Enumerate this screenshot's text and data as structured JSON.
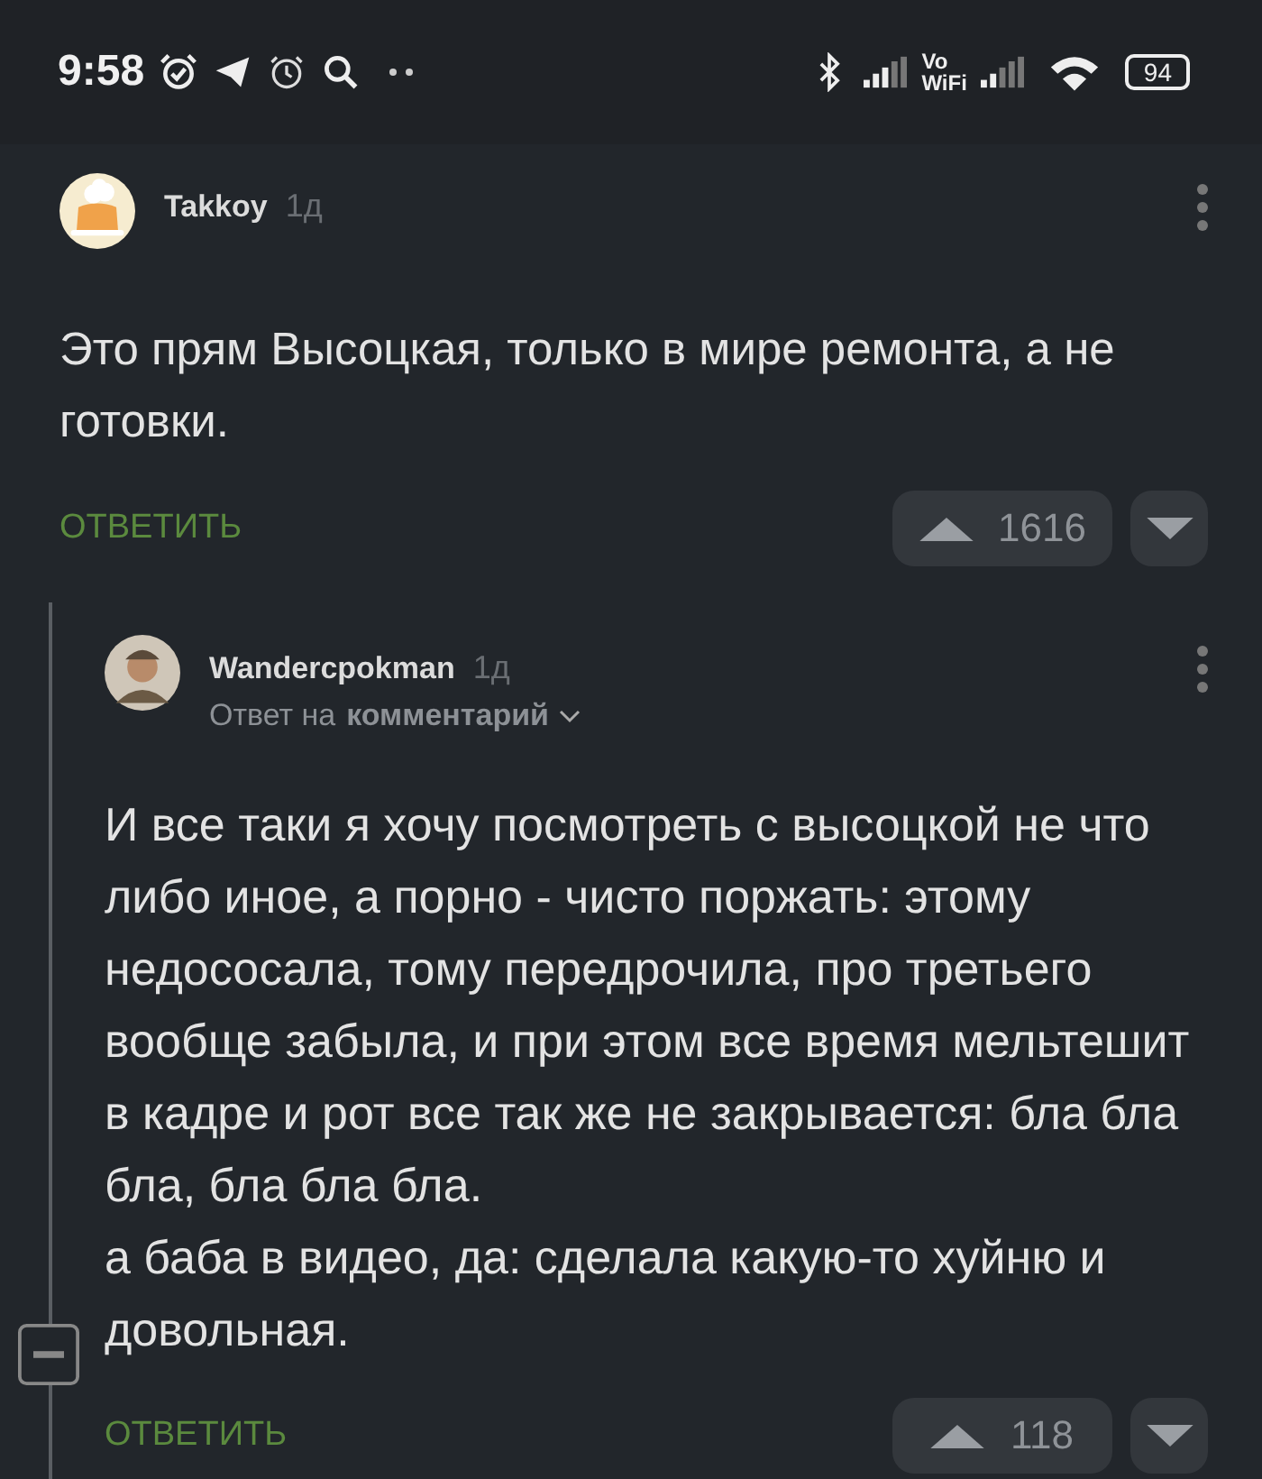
{
  "status_bar": {
    "time": "9:58",
    "vowifi": [
      "Vo",
      "WiFi"
    ],
    "battery": "94"
  },
  "comments": [
    {
      "author": "Takkoy",
      "age": "1д",
      "avatar": {
        "kind": "cartoon"
      },
      "body": [
        "Это прям Высоцкая, только в мире ремонта, а не готовки."
      ],
      "reply_label": "ОТВЕТИТЬ",
      "votes": "1616",
      "children": [
        {
          "author": "Wandercpokman",
          "age": "1д",
          "avatar": {
            "kind": "person"
          },
          "reply_to": {
            "prefix": "Ответ на",
            "target": "комментарий"
          },
          "body": [
            "И все таки я хочу посмотреть с высоцкой не что либо иное, а порно - чисто поржать: этому недососала, тому передрочила, про третьего вообще забыла, и при этом все время мельтешит в кадре и рот все так же не закрывается: бла бла бла, бла бла бла.",
            "а баба в видео, да: сделала какую-то хуйню и довольная."
          ],
          "reply_label": "ОТВЕТИТЬ",
          "votes": "118"
        }
      ]
    }
  ]
}
